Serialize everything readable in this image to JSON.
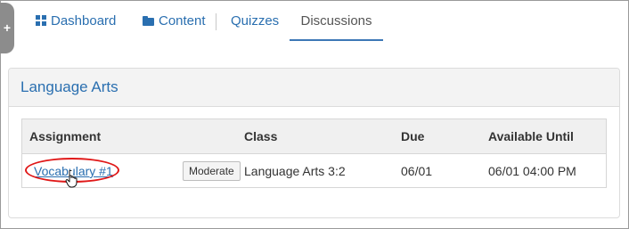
{
  "nav": {
    "items": [
      {
        "label": "Dashboard",
        "icon": "grid-icon"
      },
      {
        "label": "Content",
        "icon": "folder-icon"
      },
      {
        "label": "Quizzes"
      },
      {
        "label": "Discussions"
      }
    ],
    "active": "Discussions"
  },
  "panel": {
    "title": "Language Arts"
  },
  "table": {
    "headers": [
      "Assignment",
      "Class",
      "Due",
      "Available Until"
    ],
    "rows": [
      {
        "assignment": "Vocabulary #1",
        "action": "Moderate",
        "class": "Language Arts 3:2",
        "due": "06/01",
        "available_until": "06/01 04:00 PM"
      }
    ]
  },
  "colors": {
    "link": "#2a6fb0",
    "highlight": "#e01818",
    "side_tab": "#8c8c8c"
  }
}
